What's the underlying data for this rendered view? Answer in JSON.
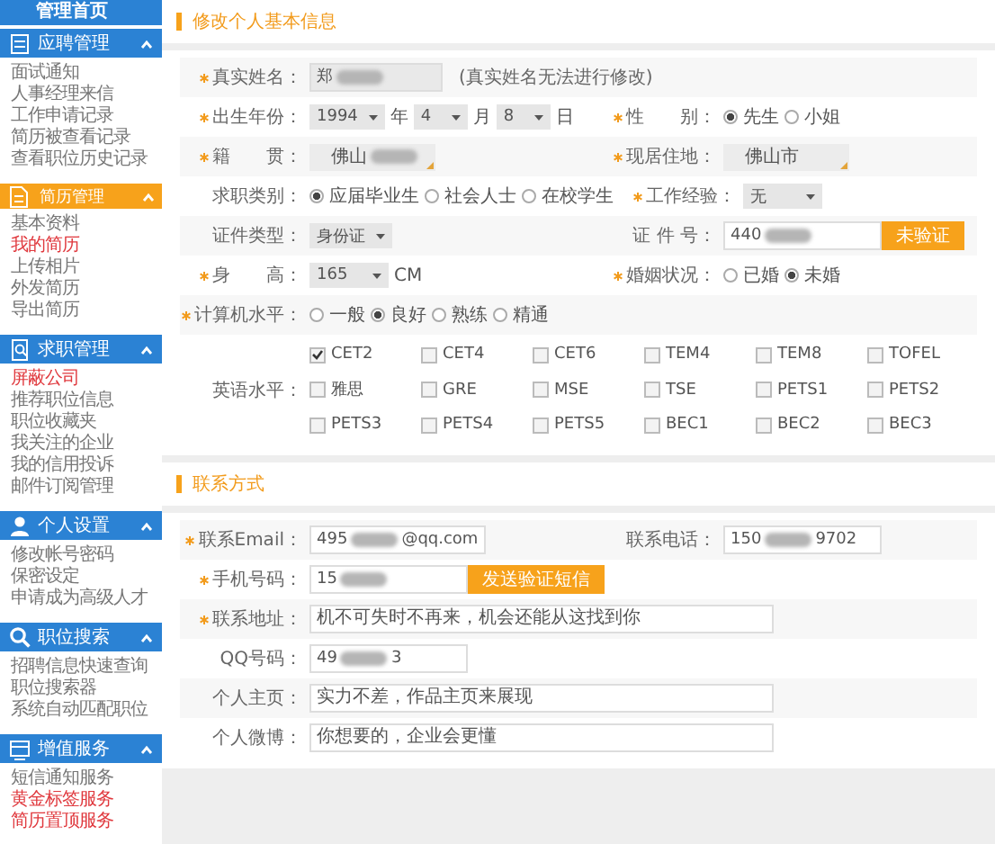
{
  "sidebar": {
    "top_item": "管理首页",
    "sections": [
      {
        "title": "应聘管理",
        "selected": false,
        "expanded": true,
        "items": [
          {
            "label": "面试通知",
            "emphasized": false
          },
          {
            "label": "人事经理来信",
            "emphasized": false
          },
          {
            "label": "工作申请记录",
            "emphasized": false
          },
          {
            "label": "简历被查看记录",
            "emphasized": false
          },
          {
            "label": "查看职位历史记录",
            "emphasized": false
          }
        ]
      },
      {
        "title": "简历管理",
        "selected": true,
        "expanded": true,
        "items": [
          {
            "label": "基本资料",
            "emphasized": false
          },
          {
            "label": "我的简历",
            "emphasized": true
          },
          {
            "label": "上传相片",
            "emphasized": false
          },
          {
            "label": "外发简历",
            "emphasized": false
          },
          {
            "label": "导出简历",
            "emphasized": false
          }
        ]
      },
      {
        "title": "求职管理",
        "selected": false,
        "expanded": true,
        "items": [
          {
            "label": "屏蔽公司",
            "emphasized": true
          },
          {
            "label": "推荐职位信息",
            "emphasized": false
          },
          {
            "label": "职位收藏夹",
            "emphasized": false
          },
          {
            "label": "我关注的企业",
            "emphasized": false
          },
          {
            "label": "我的信用投诉",
            "emphasized": false
          },
          {
            "label": "邮件订阅管理",
            "emphasized": false
          }
        ]
      },
      {
        "title": "个人设置",
        "selected": false,
        "expanded": true,
        "items": [
          {
            "label": "修改帐号密码",
            "emphasized": false
          },
          {
            "label": "保密设定",
            "emphasized": false
          },
          {
            "label": "申请成为高级人才",
            "emphasized": false
          }
        ]
      },
      {
        "title": "职位搜索",
        "selected": false,
        "expanded": true,
        "items": [
          {
            "label": "招聘信息快速查询",
            "emphasized": false
          },
          {
            "label": "职位搜索器",
            "emphasized": false
          },
          {
            "label": "系统自动匹配职位",
            "emphasized": false
          }
        ]
      },
      {
        "title": "增值服务",
        "selected": false,
        "expanded": true,
        "items": [
          {
            "label": "短信通知服务",
            "emphasized": false
          },
          {
            "label": "黄金标签服务",
            "emphasized": true
          },
          {
            "label": "简历置顶服务",
            "emphasized": true
          }
        ]
      }
    ]
  },
  "basic_info": {
    "title": "修改个人基本信息",
    "rows": [
      {
        "fields": [
          {
            "kind": "text",
            "label": "真实姓名：",
            "required": true,
            "value": "郑",
            "disabled": true,
            "note": "(真实姓名无法进行修改)"
          }
        ]
      },
      {
        "fields": [
          {
            "kind": "date",
            "label": "出生年份：",
            "required": true,
            "parts": [
              {
                "value": "1994",
                "unit": "年"
              },
              {
                "value": "4",
                "unit": "月"
              },
              {
                "value": "8",
                "unit": "日"
              }
            ]
          },
          {
            "kind": "radio",
            "label": "性　　别：",
            "required": true,
            "options": [
              {
                "label": "先生",
                "selected": true
              },
              {
                "label": "小姐",
                "selected": false
              }
            ]
          }
        ]
      },
      {
        "fields": [
          {
            "kind": "picker",
            "label": "籍　　贯：",
            "required": true,
            "value": "佛山"
          },
          {
            "kind": "picker",
            "label": "现居住地：",
            "required": true,
            "value": "佛山市"
          }
        ]
      },
      {
        "fields": [
          {
            "kind": "radio",
            "label": "求职类别：",
            "required": false,
            "options": [
              {
                "label": "应届毕业生",
                "selected": true
              },
              {
                "label": "社会人士",
                "selected": false
              },
              {
                "label": "在校学生",
                "selected": false
              }
            ]
          },
          {
            "kind": "select",
            "label": "工作经验：",
            "required": true,
            "value": "无"
          }
        ]
      },
      {
        "fields": [
          {
            "kind": "select",
            "label": "证件类型：",
            "required": false,
            "value": "身份证"
          },
          {
            "kind": "text",
            "label": "证 件 号：",
            "required": false,
            "value": "440",
            "disabled": false,
            "button": "未验证"
          }
        ]
      },
      {
        "fields": [
          {
            "kind": "select",
            "label": "身　　高：",
            "required": true,
            "value": "165",
            "unit": "CM"
          },
          {
            "kind": "radio",
            "label": "婚姻状况：",
            "required": true,
            "options": [
              {
                "label": "已婚",
                "selected": false
              },
              {
                "label": "未婚",
                "selected": true
              }
            ]
          }
        ]
      },
      {
        "fields": [
          {
            "kind": "radio",
            "label": "计算机水平：",
            "required": true,
            "options": [
              {
                "label": "一般",
                "selected": false
              },
              {
                "label": "良好",
                "selected": true
              },
              {
                "label": "熟练",
                "selected": false
              },
              {
                "label": "精通",
                "selected": false
              }
            ]
          }
        ]
      },
      {
        "fields": [
          {
            "kind": "checks",
            "label": "英语水平：",
            "required": false,
            "options": [
              {
                "label": "CET2",
                "checked": true
              },
              {
                "label": "CET4",
                "checked": false
              },
              {
                "label": "CET6",
                "checked": false
              },
              {
                "label": "TEM4",
                "checked": false
              },
              {
                "label": "TEM8",
                "checked": false
              },
              {
                "label": "TOFEL",
                "checked": false
              },
              {
                "label": "雅思",
                "checked": false
              },
              {
                "label": "GRE",
                "checked": false
              },
              {
                "label": "MSE",
                "checked": false
              },
              {
                "label": "TSE",
                "checked": false
              },
              {
                "label": "PETS1",
                "checked": false
              },
              {
                "label": "PETS2",
                "checked": false
              },
              {
                "label": "PETS3",
                "checked": false
              },
              {
                "label": "PETS4",
                "checked": false
              },
              {
                "label": "PETS5",
                "checked": false
              },
              {
                "label": "BEC1",
                "checked": false
              },
              {
                "label": "BEC2",
                "checked": false
              },
              {
                "label": "BEC3",
                "checked": false
              }
            ]
          }
        ]
      }
    ]
  },
  "contact": {
    "title": "联系方式",
    "rows": [
      {
        "fields": [
          {
            "kind": "text",
            "label": "联系Email：",
            "required": true,
            "value": "495",
            "tail": "@qq.com"
          },
          {
            "kind": "text",
            "label": "联系电话：",
            "required": false,
            "value": "150",
            "tail": "9702"
          }
        ]
      },
      {
        "fields": [
          {
            "kind": "text",
            "label": "手机号码：",
            "required": true,
            "value": "15",
            "button": "发送验证短信"
          }
        ]
      },
      {
        "fields": [
          {
            "kind": "wide",
            "label": "联系地址：",
            "required": true,
            "value": "机不可失时不再来，机会还能从这找到你"
          }
        ]
      },
      {
        "fields": [
          {
            "kind": "text",
            "label": "QQ号码：",
            "required": false,
            "value": "49",
            "tail": "3"
          }
        ]
      },
      {
        "fields": [
          {
            "kind": "wide",
            "label": "个人主页：",
            "required": false,
            "value": "实力不差，作品主页来展现"
          }
        ]
      },
      {
        "fields": [
          {
            "kind": "wide",
            "label": "个人微博：",
            "required": false,
            "value": "你想要的，企业会更懂"
          }
        ]
      }
    ]
  }
}
